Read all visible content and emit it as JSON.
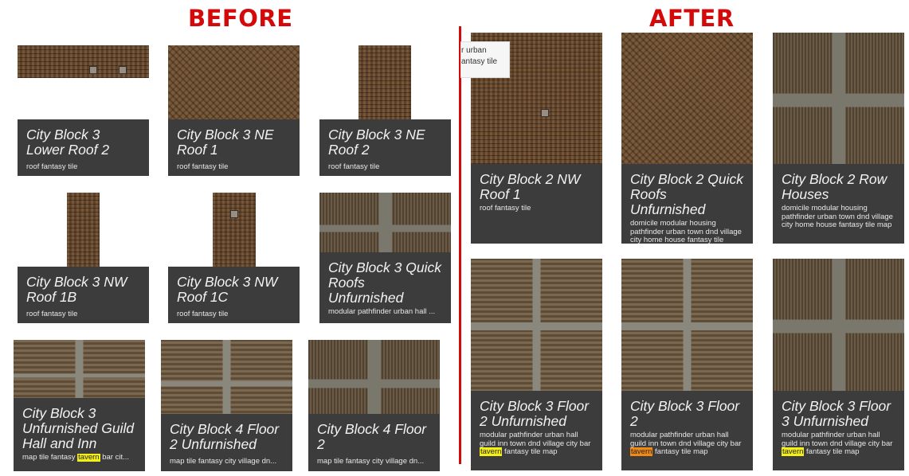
{
  "before_heading": "BEFORE",
  "after_heading": "AFTER",
  "tooltip": {
    "line1": "r urban",
    "line2": "antasy tile"
  },
  "before": [
    {
      "title": "City Block 3 Lower Roof 2",
      "desc": "roof fantasy tile"
    },
    {
      "title": "City Block 3 NE Roof 1",
      "desc": "roof fantasy tile"
    },
    {
      "title": "City Block 3 NE Roof 2",
      "desc": "roof fantasy tile"
    },
    {
      "title": "City Block 3 NW Roof 1B",
      "desc": "roof fantasy tile"
    },
    {
      "title": "City Block 3 NW Roof 1C",
      "desc": "roof fantasy tile"
    },
    {
      "title": "City Block 3 Quick Roofs Unfurnished",
      "desc": "modular pathfinder urban hall ..."
    },
    {
      "title": "City Block 3 Unfurnished Guild Hall and Inn",
      "desc_before": "map tile fantasy ",
      "desc_hl": "tavern",
      "desc_after": " bar cit..."
    },
    {
      "title": "City Block 4 Floor 2 Unfurnished",
      "desc": "map tile fantasy city village dn..."
    },
    {
      "title": "City Block 4 Floor 2",
      "desc": "map tile fantasy city village dn..."
    }
  ],
  "after": [
    {
      "title": "City Block 2 NW Roof 1",
      "desc": "roof fantasy tile"
    },
    {
      "title": "City Block 2 Quick Roofs Unfurnished",
      "desc": "domicile modular housing pathfinder urban town dnd village city home house fantasy tile"
    },
    {
      "title": "City Block 2 Row Houses",
      "desc": "domicile modular housing pathfinder urban town dnd village city home house fantasy tile map"
    },
    {
      "title": "City Block 3 Floor 2 Unfurnished",
      "desc_before": "modular pathfinder urban hall guild inn town dnd village city bar ",
      "desc_hl": "tavern",
      "desc_after": " fantasy tile map"
    },
    {
      "title": "City Block 3 Floor 2",
      "desc_before": "modular pathfinder urban hall guild inn town dnd village city bar ",
      "desc_hl": "tavern",
      "desc_after": " fantasy tile map"
    },
    {
      "title": "City Block 3 Floor 3 Unfurnished",
      "desc_before": "modular pathfinder urban hall guild inn town dnd village city bar ",
      "desc_hl": "tavern",
      "desc_after": " fantasy tile map"
    }
  ]
}
